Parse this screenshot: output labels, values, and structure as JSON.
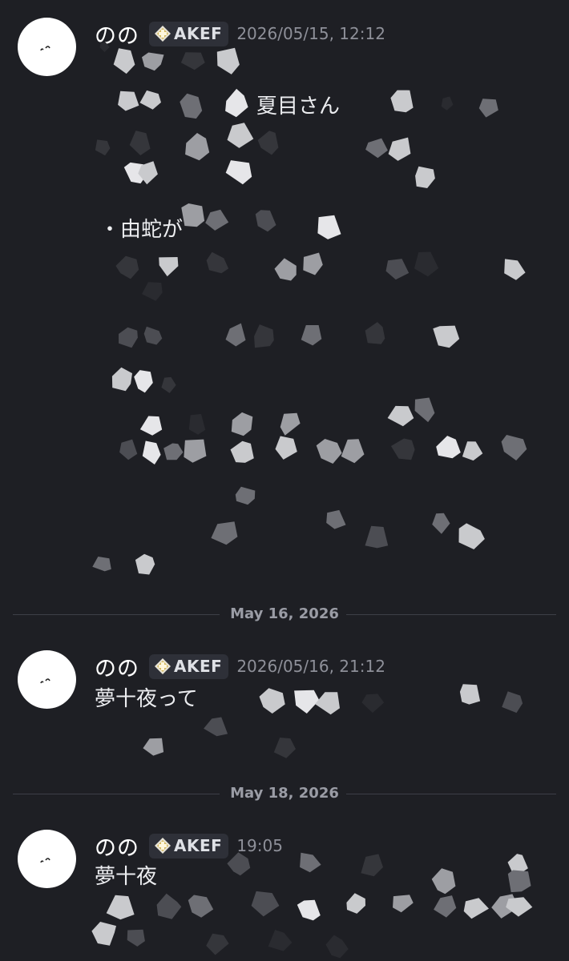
{
  "messages": [
    {
      "username": "のの",
      "tag": "AKEF",
      "timestamp": "2026/05/15, 12:12",
      "lines": [
        "夏目さん",
        "・由蛇が"
      ]
    },
    {
      "username": "のの",
      "tag": "AKEF",
      "timestamp": "2026/05/16, 21:12",
      "lines": [
        "夢十夜って"
      ]
    },
    {
      "username": "のの",
      "tag": "AKEF",
      "timestamp": "19:05",
      "lines": [
        "夢十夜"
      ]
    }
  ],
  "dividers": [
    "May 16, 2026",
    "May 18, 2026"
  ],
  "colors": {
    "background": "#1e1f24",
    "username": "#ffffff",
    "timestamp": "#8e9099",
    "tag_background": "#2e3038",
    "tag_icon": "#d4b75a",
    "divider_line": "#3d3f47"
  },
  "icons": [
    "avatar-face",
    "akef-tag-icon"
  ]
}
